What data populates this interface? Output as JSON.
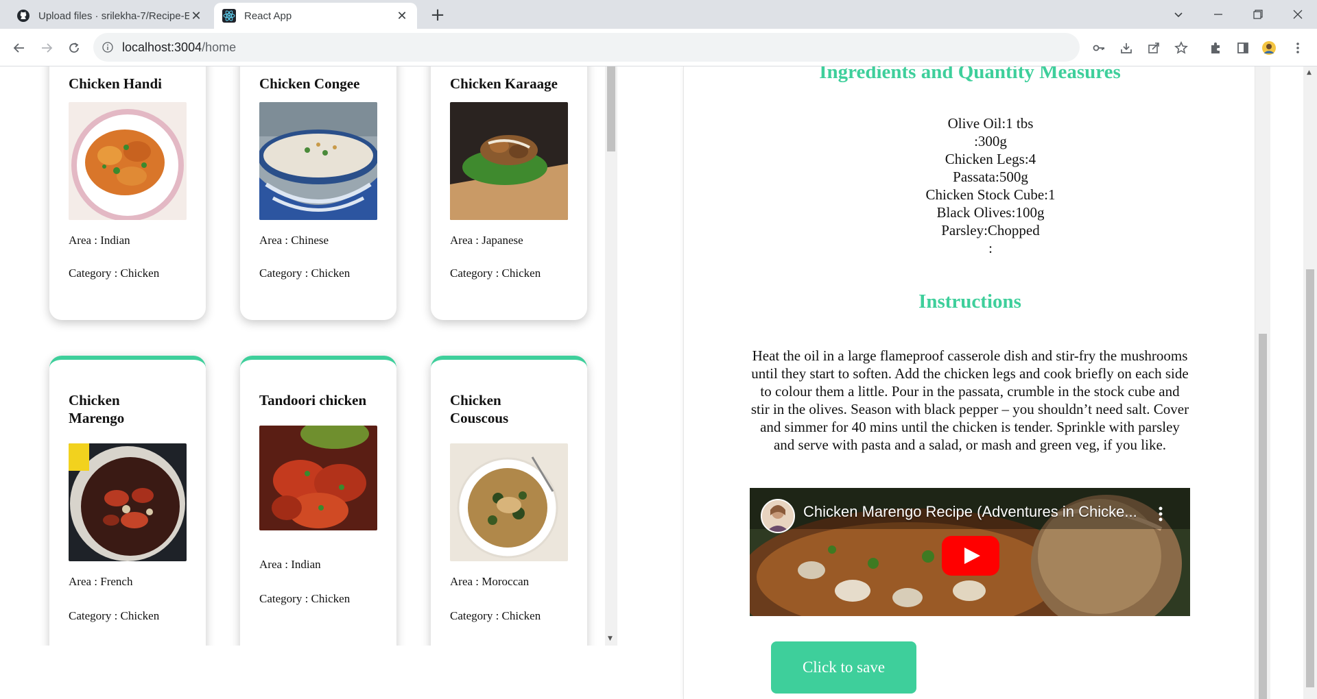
{
  "browser": {
    "tabs": [
      {
        "label": "Upload files · srilekha-7/Recipe-E",
        "active": false,
        "icon": "github-icon"
      },
      {
        "label": "React App",
        "active": true,
        "icon": "react-icon"
      }
    ],
    "new_tab_label": "+",
    "url_host": "localhost:3004",
    "url_path": "/home"
  },
  "recipes": [
    {
      "name": "Chicken Handi",
      "area": "Area : Indian",
      "category": "Category : Chicken"
    },
    {
      "name": "Chicken Congee",
      "area": "Area : Chinese",
      "category": "Category : Chicken"
    },
    {
      "name": "Chicken Karaage",
      "area": "Area : Japanese",
      "category": "Category : Chicken"
    },
    {
      "name": "Chicken Marengo",
      "area": "Area : French",
      "category": "Category : Chicken"
    },
    {
      "name": "Tandoori chicken",
      "area": "Area : Indian",
      "category": "Category : Chicken"
    },
    {
      "name": "Chicken Couscous",
      "area": "Area : Moroccan",
      "category": "Category : Chicken"
    }
  ],
  "detail": {
    "ingredients_title": "Ingredients and Quantity Measures",
    "ingredients": [
      "Olive Oil:1 tbs",
      ":300g",
      "Chicken Legs:4",
      "Passata:500g",
      "Chicken Stock Cube:1",
      "Black Olives:100g",
      "Parsley:Chopped",
      ":"
    ],
    "instructions_title": "Instructions",
    "instructions": "Heat the oil in a large flameproof casserole dish and stir-fry the mushrooms until they start to soften. Add the chicken legs and cook briefly on each side to colour them a little. Pour in the passata, crumble in the stock cube and stir in the olives. Season with black pepper – you shouldn’t need salt. Cover and simmer for 40 mins until the chicken is tender. Sprinkle with parsley and serve with pasta and a salad, or mash and green veg, if you like.",
    "video_title": "Chicken Marengo Recipe (Adventures in Chicke...",
    "save_label": "Click to save"
  },
  "colors": {
    "accent": "#3ecf9b",
    "youtube_red": "#ff0000"
  }
}
